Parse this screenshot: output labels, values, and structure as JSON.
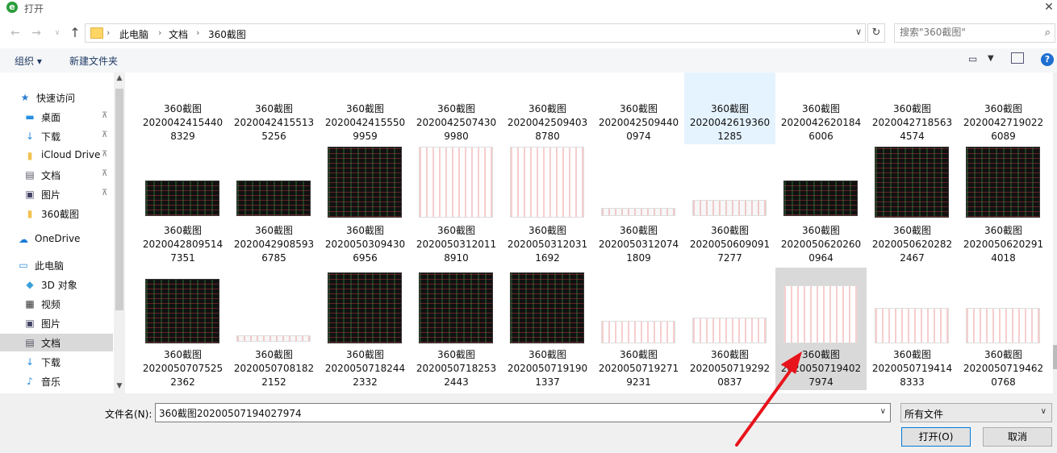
{
  "window": {
    "title": "打开",
    "close_glyph": "✕"
  },
  "nav": {
    "back_glyph": "←",
    "forward_glyph": "→",
    "recent_glyph": "∨",
    "up_glyph": "↑",
    "breadcrumbs": [
      "此电脑",
      "文档",
      "360截图"
    ],
    "separator": "›",
    "refresh_glyph": "↻",
    "search_placeholder": "搜索\"360截图\"",
    "search_glyph": "⌕"
  },
  "toolbar": {
    "organize": "组织 ▾",
    "new_folder": "新建文件夹",
    "help": "?"
  },
  "sidebar": {
    "items": [
      {
        "icon": "star-icon",
        "glyph": "★",
        "label": "快速访问",
        "pinned": false
      },
      {
        "icon": "desktop-icon",
        "glyph": "▬",
        "label": "桌面",
        "pinned": true
      },
      {
        "icon": "download-icon",
        "glyph": "↓",
        "label": "下载",
        "pinned": true
      },
      {
        "icon": "folder-icon",
        "glyph": "▮",
        "label": "iCloud Drive",
        "pinned": true
      },
      {
        "icon": "document-icon",
        "glyph": "▤",
        "label": "文档",
        "pinned": true
      },
      {
        "icon": "pictures-icon",
        "glyph": "▣",
        "label": "图片",
        "pinned": true
      },
      {
        "icon": "folder-icon",
        "glyph": "▮",
        "label": "360截图",
        "pinned": false
      },
      {
        "icon": "onedrive-icon",
        "glyph": "☁",
        "label": "OneDrive",
        "pinned": false
      },
      {
        "icon": "computer-icon",
        "glyph": "▭",
        "label": "此电脑",
        "pinned": false
      },
      {
        "icon": "3d-objects-icon",
        "glyph": "◆",
        "label": "3D 对象",
        "pinned": false
      },
      {
        "icon": "video-icon",
        "glyph": "▦",
        "label": "视频",
        "pinned": false
      },
      {
        "icon": "pictures-icon",
        "glyph": "▣",
        "label": "图片",
        "pinned": false
      },
      {
        "icon": "document-icon",
        "glyph": "▤",
        "label": "文档",
        "pinned": false,
        "selected": true
      },
      {
        "icon": "download-icon",
        "glyph": "↓",
        "label": "下载",
        "pinned": false
      },
      {
        "icon": "music-icon",
        "glyph": "♪",
        "label": "音乐",
        "pinned": false
      }
    ],
    "pin_glyph": "📌"
  },
  "files": {
    "rows": [
      [
        {
          "name": "360截图",
          "id1": "2020042415440",
          "id2": "8329"
        },
        {
          "name": "360截图",
          "id1": "2020042415513",
          "id2": "5256"
        },
        {
          "name": "360截图",
          "id1": "2020042415550",
          "id2": "9959"
        },
        {
          "name": "360截图",
          "id1": "2020042507430",
          "id2": "9980"
        },
        {
          "name": "360截图",
          "id1": "2020042509403",
          "id2": "8780"
        },
        {
          "name": "360截图",
          "id1": "2020042509440",
          "id2": "0974"
        },
        {
          "name": "360截图",
          "id1": "2020042619360",
          "id2": "1285"
        },
        {
          "name": "360截图",
          "id1": "2020042620184",
          "id2": "6006"
        },
        {
          "name": "360截图",
          "id1": "2020042718563",
          "id2": "4574"
        },
        {
          "name": "360截图",
          "id1": "2020042719022",
          "id2": "6089"
        }
      ],
      [
        {
          "name": "360截图",
          "id1": "2020042809514",
          "id2": "7351"
        },
        {
          "name": "360截图",
          "id1": "2020042908593",
          "id2": "6785"
        },
        {
          "name": "360截图",
          "id1": "2020050309430",
          "id2": "6956"
        },
        {
          "name": "360截图",
          "id1": "2020050312011",
          "id2": "8910"
        },
        {
          "name": "360截图",
          "id1": "2020050312031",
          "id2": "1692"
        },
        {
          "name": "360截图",
          "id1": "2020050312074",
          "id2": "1809"
        },
        {
          "name": "360截图",
          "id1": "2020050609091",
          "id2": "7277"
        },
        {
          "name": "360截图",
          "id1": "2020050620260",
          "id2": "0964"
        },
        {
          "name": "360截图",
          "id1": "2020050620282",
          "id2": "2467"
        },
        {
          "name": "360截图",
          "id1": "2020050620291",
          "id2": "4018"
        }
      ],
      [
        {
          "name": "360截图",
          "id1": "2020050707525",
          "id2": "2362"
        },
        {
          "name": "360截图",
          "id1": "2020050708182",
          "id2": "2152"
        },
        {
          "name": "360截图",
          "id1": "2020050718244",
          "id2": "2332"
        },
        {
          "name": "360截图",
          "id1": "2020050718253",
          "id2": "2443"
        },
        {
          "name": "360截图",
          "id1": "2020050719190",
          "id2": "1337"
        },
        {
          "name": "360截图",
          "id1": "2020050719271",
          "id2": "9231"
        },
        {
          "name": "360截图",
          "id1": "2020050719292",
          "id2": "0837"
        },
        {
          "name": "360截图",
          "id1": "2020050719402",
          "id2": "7974"
        },
        {
          "name": "360截图",
          "id1": "2020050719414",
          "id2": "8333"
        },
        {
          "name": "360截图",
          "id1": "2020050719462",
          "id2": "0768"
        }
      ]
    ]
  },
  "footer": {
    "filename_label": "文件名(N):",
    "filename_value": "360截图20200507194027974",
    "filetype": "所有文件",
    "open": "打开(O)",
    "cancel": "取消",
    "drop_glyph": "∨"
  },
  "colors": {
    "accent": "#0078d7",
    "annotation": "#e8141c",
    "hover": "#e5f3ff",
    "selected": "#d9d9d9"
  }
}
